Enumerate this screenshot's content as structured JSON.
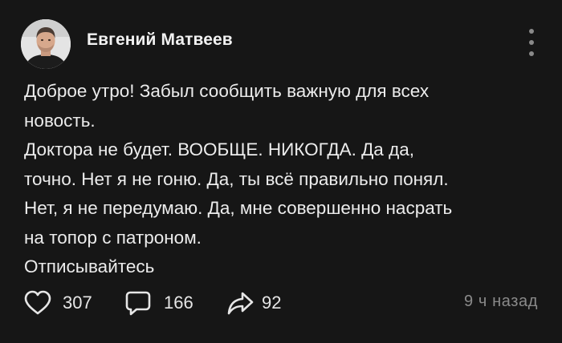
{
  "author": {
    "name": "Евгений Матвеев"
  },
  "post": {
    "lines": [
      "Доброе утро! Забыл сообщить важную для всех",
      "новость.",
      "Доктора не будет. ВООБЩЕ. НИКОГДА. Да да,",
      "точно. Нет я не гоню. Да, ты всё правильно понял.",
      "Нет, я не передумаю. Да, мне совершенно насрать",
      "на топор с патроном.",
      "Отписывайтесь"
    ]
  },
  "stats": {
    "likes": "307",
    "comments": "166",
    "shares": "92"
  },
  "timestamp": "9 ч назад",
  "icons": {
    "like": "heart-icon",
    "comment": "comment-bubble-icon",
    "share": "share-arrow-icon",
    "more": "more-vertical-icon"
  },
  "colors": {
    "background": "#161616",
    "text": "#ececec",
    "muted": "#8a8a8a"
  }
}
